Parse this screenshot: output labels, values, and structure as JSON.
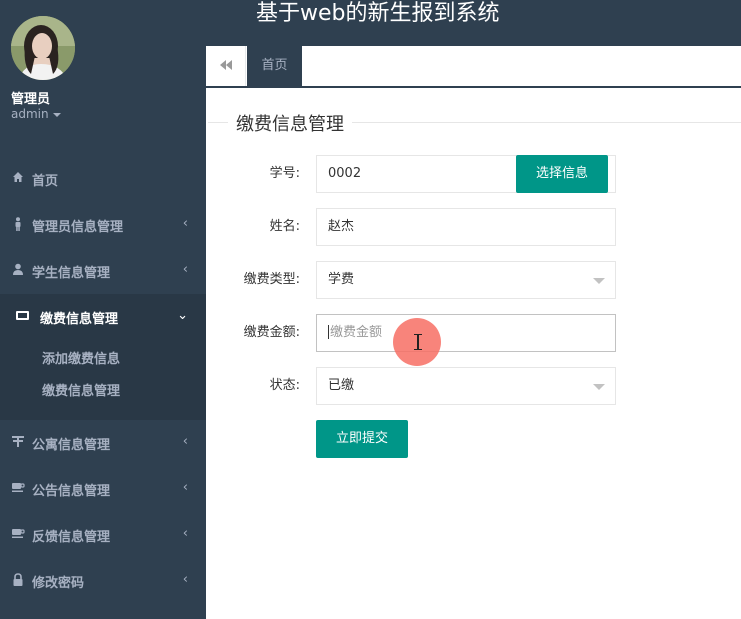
{
  "app": {
    "title": "基于web的新生报到系统"
  },
  "user": {
    "name": "管理员",
    "role": "admin"
  },
  "sidebar": {
    "items": [
      {
        "label": "首页",
        "icon": "home-icon"
      },
      {
        "label": "管理员信息管理",
        "icon": "male-icon"
      },
      {
        "label": "学生信息管理",
        "icon": "user-icon"
      },
      {
        "label": "缴费信息管理",
        "icon": "monitor-icon",
        "expanded": true
      },
      {
        "label": "公寓信息管理",
        "icon": "building-icon"
      },
      {
        "label": "公告信息管理",
        "icon": "coffee-icon"
      },
      {
        "label": "反馈信息管理",
        "icon": "coffee-icon"
      },
      {
        "label": "修改密码",
        "icon": "lock-icon"
      }
    ],
    "subitems": [
      {
        "label": "添加缴费信息"
      },
      {
        "label": "缴费信息管理"
      }
    ]
  },
  "tabs": {
    "home_label": "首页"
  },
  "form": {
    "legend": "缴费信息管理",
    "student_id": {
      "label": "学号:",
      "value": "0002",
      "button": "选择信息"
    },
    "name": {
      "label": "姓名:",
      "value": "赵杰"
    },
    "fee_type": {
      "label": "缴费类型:",
      "value": "学费"
    },
    "amount": {
      "label": "缴费金额:",
      "value": "",
      "placeholder": "缴费金额"
    },
    "status": {
      "label": "状态:",
      "value": "已缴"
    },
    "submit_label": "立即提交"
  },
  "colors": {
    "sidebar": "#2f4050",
    "accent": "#009688",
    "click": "#f76e64"
  }
}
